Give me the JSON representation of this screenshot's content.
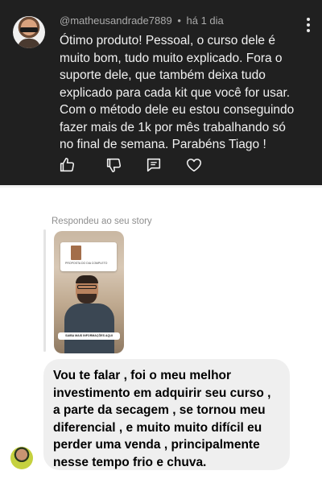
{
  "comment": {
    "username": "@matheusandrade7889",
    "separator": "•",
    "time": "há 1 dia",
    "text": "Ótimo produto! Pessoal, o curso dele é muito bom, tudo muito explicado. Fora o suporte dele, que também deixa tudo explicado para cada kit que você for usar. Com o método dele eu estou conseguindo fazer mais de 1k por mês trabalhando só no final de semana. Parabéns Tiago !",
    "actions": [
      "like-icon",
      "dislike-icon",
      "reply-icon",
      "heart-icon"
    ]
  },
  "dm": {
    "replied_label": "Respondeu ao seu story",
    "story": {
      "card_text": "PROPOSTA DO DIA COMPLETO",
      "cta_text": "SAIBA MAIS INFORMAÇÕES AQUI"
    },
    "message": "Vou te falar , foi o meu melhor investimento em adquirir seu curso , a parte da secagem , se tornou meu diferencial , e muito muito difícil eu perder uma venda , principalmente nesse  tempo frio e chuva."
  },
  "colors": {
    "dark_bg": "#202020",
    "comment_text": "#f1f1f1",
    "meta_text": "#aaaaaa",
    "bubble_bg": "#efefef",
    "label_gray": "#8e8e8e"
  }
}
